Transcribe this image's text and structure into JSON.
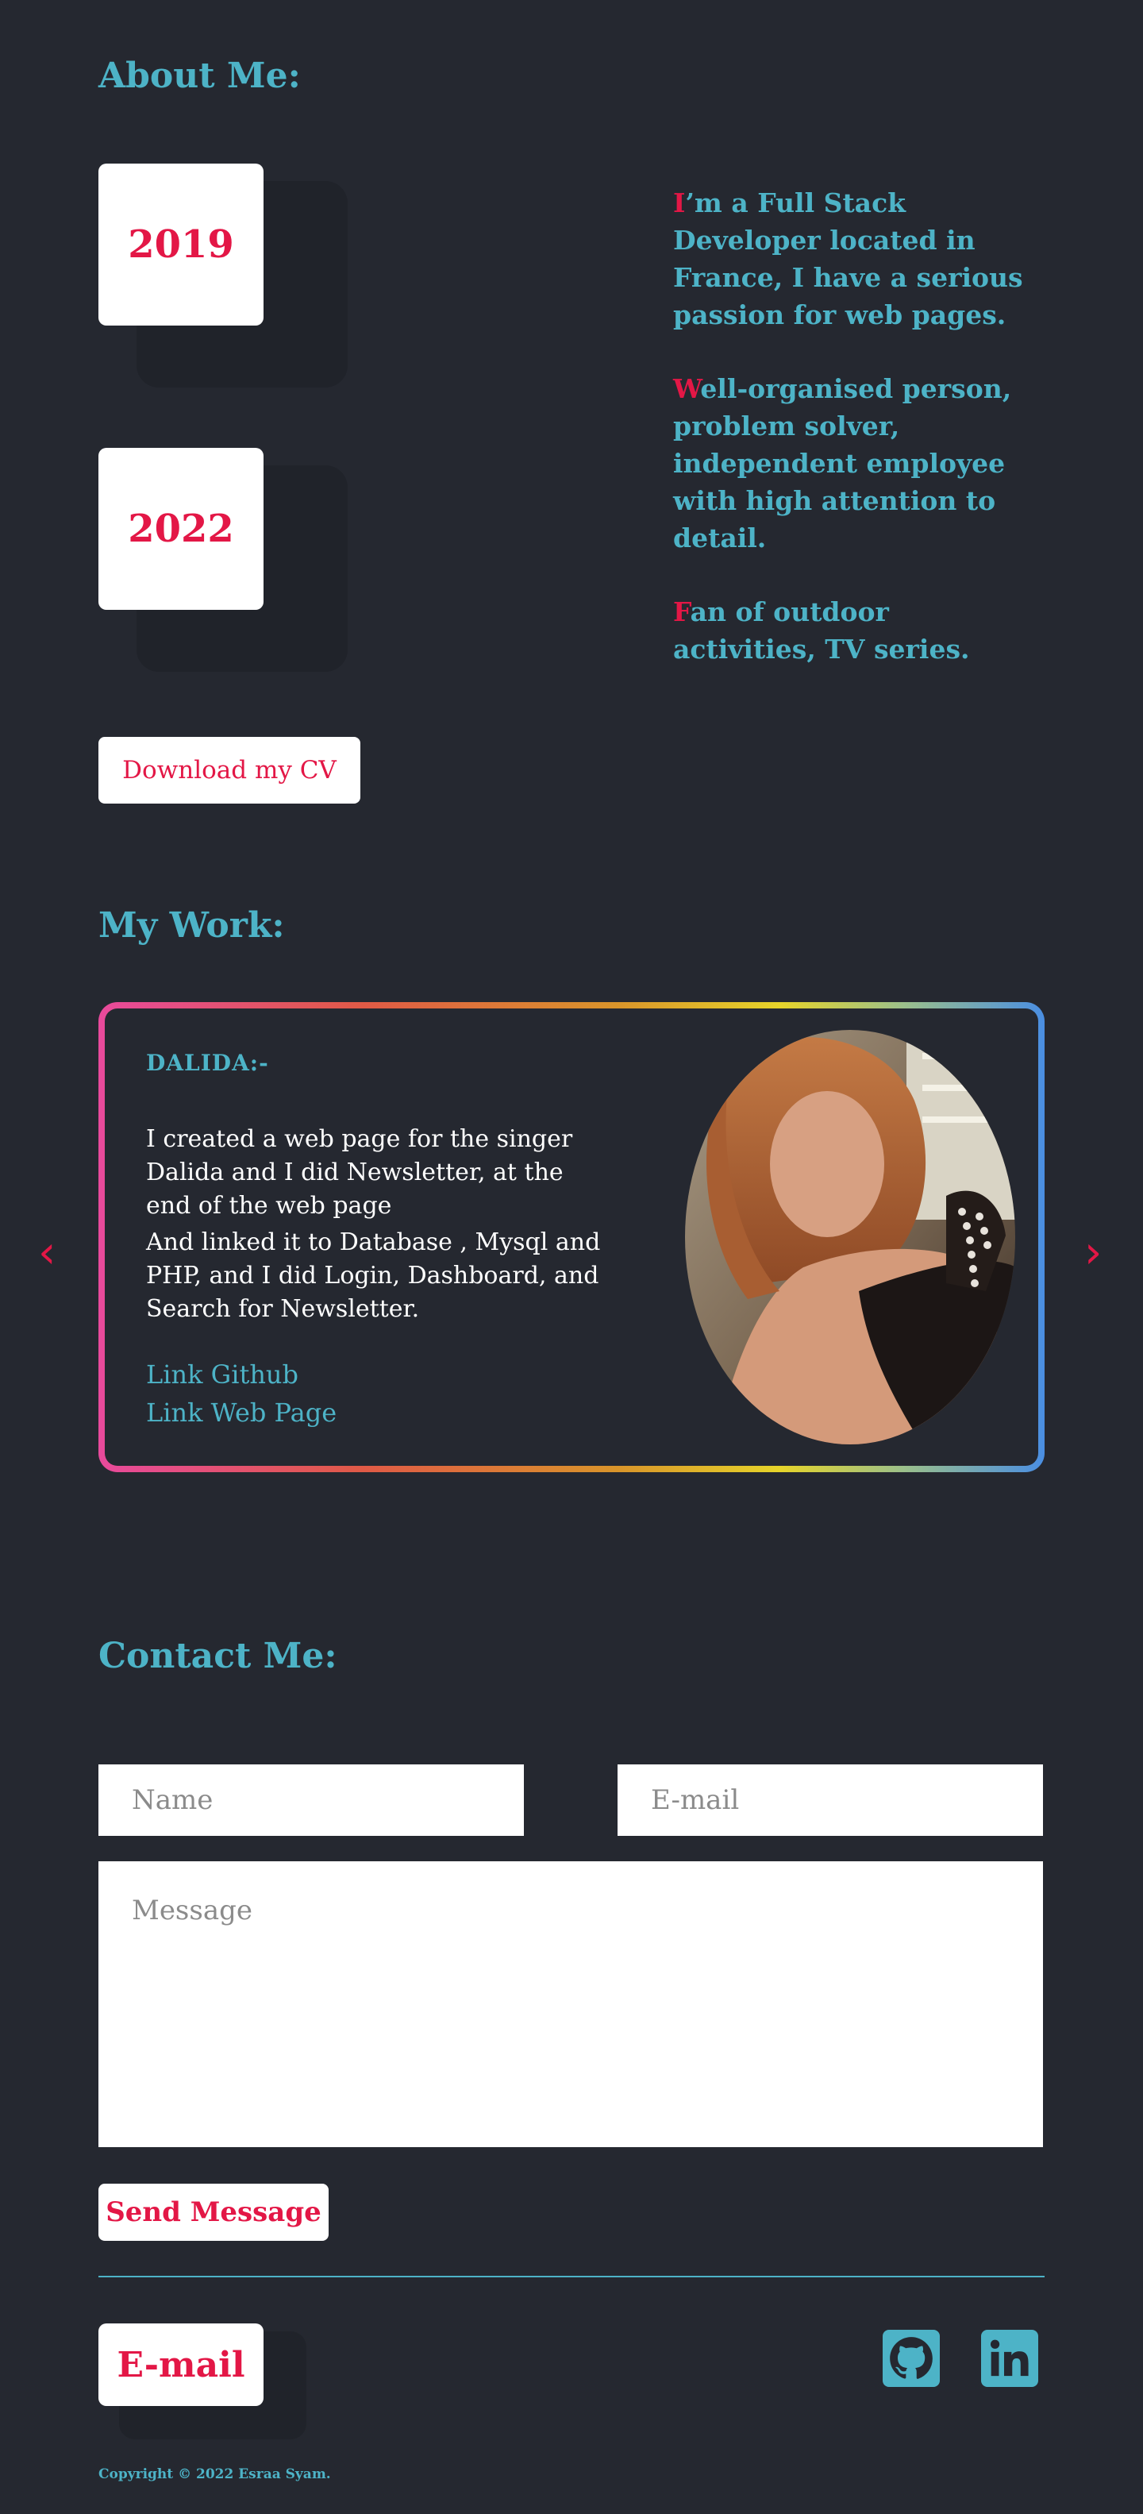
{
  "about": {
    "title": "About Me:",
    "years": [
      "2019",
      "2022"
    ],
    "paragraphs": [
      {
        "initial": "I",
        "rest": "’m a Full Stack Developer located in France, I have a serious passion for web pages."
      },
      {
        "initial": "W",
        "rest": "ell-organised person, problem solver, independent employee with high attention to detail."
      },
      {
        "initial": "F",
        "rest": "an of outdoor activities, TV series."
      }
    ],
    "cv_button": "Download my CV"
  },
  "work": {
    "title": "My Work:",
    "project": {
      "name": "DALIDA:-",
      "desc1": "I created a web page for the singer Dalida and I did Newsletter, at the end of the web page",
      "desc2": "And linked it to Database , Mysql and PHP, and I did Login, Dashboard, and Search for Newsletter.",
      "link_github": "Link Github",
      "link_web": "Link Web Page"
    },
    "prev_arrow": "‹",
    "next_arrow": "›"
  },
  "contact": {
    "title": "Contact Me:",
    "name_placeholder": "Name",
    "email_placeholder": "E-mail",
    "message_placeholder": "Message",
    "send_button": "Send Message"
  },
  "footer": {
    "email_button": "E-mail",
    "copyright": "Copyright © 2022 Esraa Syam.",
    "icons": [
      "github-icon",
      "linkedin-icon"
    ]
  },
  "colors": {
    "background": "#252830",
    "accent_teal": "#4db3c7",
    "accent_red": "#e31746"
  }
}
